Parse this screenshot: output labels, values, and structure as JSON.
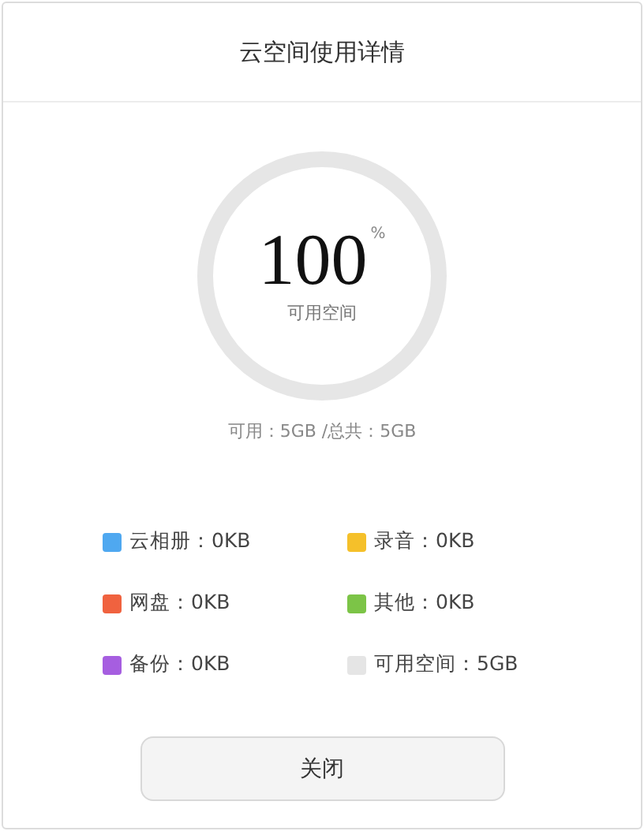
{
  "dialog": {
    "title": "云空间使用详情"
  },
  "ring": {
    "percent": "100",
    "unit": "%",
    "label": "可用空间"
  },
  "summary": "可用：5GB /总共：5GB",
  "legend": [
    {
      "label": "云相册：0KB",
      "color": "#4fa8f0"
    },
    {
      "label": "录音：0KB",
      "color": "#f5c02a"
    },
    {
      "label": "网盘：0KB",
      "color": "#f0623f"
    },
    {
      "label": "其他：0KB",
      "color": "#7cc447"
    },
    {
      "label": "备份：0KB",
      "color": "#a65ee0"
    },
    {
      "label": "可用空间：5GB",
      "color": "#e5e5e5"
    }
  ],
  "close_button": "关闭"
}
